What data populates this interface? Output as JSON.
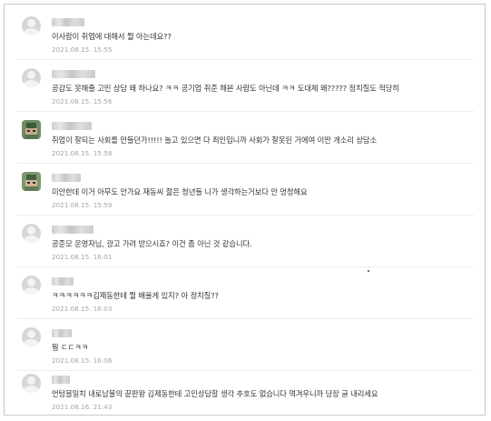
{
  "comments": [
    {
      "text": "이사람이 취업에 대해서 뭘 아는데요??",
      "date": "2021.08.15. 15:55",
      "avatar": "default-avatar"
    },
    {
      "text": "공감도 못해줄 고민 상담 왜 하나요? ㅋㅋ 공기업 취준 해본 사람도 아닌데 ㅋㅋ 도대체 왜????? 정치질도 적당히",
      "date": "2021.08.15. 15:56",
      "avatar": "default-avatar"
    },
    {
      "text": "취업이 잘되는 사회를 만들던가!!!!! 놀고 있으면 다 죄인입니까 사회가 잘못된 거에여 이딴 개소리 상담소",
      "date": "2021.08.15. 15:58",
      "avatar": "pixel-avatar"
    },
    {
      "text": "미안한데 이거 아무도 안가요 재동씨 젊은 청년들 니가 생각하는거보다 안 멍청해요",
      "date": "2021.08.15. 15:59",
      "avatar": "pixel-avatar"
    },
    {
      "text": "공준모 운영자님, 광고 가려 받으시죠? 이건 좀 아닌 것 같습니다.",
      "date": "2021.08.15. 16:01",
      "avatar": "default-avatar"
    },
    {
      "text": "ㅋㅋㅋㅋㅋㅋ김제동한테 뭘 배울게 있지? 아 정치질??",
      "date": "2021.08.15. 16:03",
      "avatar": "default-avatar"
    },
    {
      "text": "뭥 ㄷㄷㅋㅋ",
      "date": "2021.08.15. 16:06",
      "avatar": "default-avatar"
    },
    {
      "text": "언텅블일치 내로남불의 끝판왕 김제동한테 고민상담할 생각 추호도 없습니다 역겨우니까 당장 글 내리세요",
      "date": "2021.08.16. 21:43",
      "avatar": "default-avatar"
    }
  ]
}
